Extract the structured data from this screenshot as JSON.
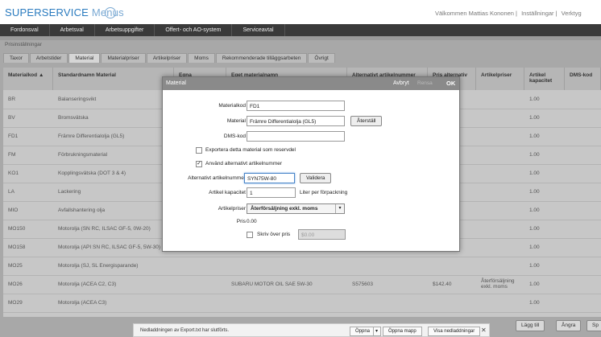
{
  "header": {
    "logo_main": "SUPERSERVICE",
    "logo_sub": "Menus",
    "welcome": "Välkommen Mattias Kononen",
    "links": [
      "Inställningar",
      "Verktyg"
    ]
  },
  "mainnav": [
    "Fordonsval",
    "Arbetsval",
    "Arbetsuppgifter",
    "Offert- och AO-system",
    "Serviceavtal"
  ],
  "panel": {
    "title": "Prisinställningar",
    "tabs": [
      "Taxor",
      "Arbetstider",
      "Material",
      "Materialpriser",
      "Artikelpriser",
      "Moms",
      "Rekommenderade tilläggsarbeten",
      "Övrigt"
    ],
    "active_tab": "Material"
  },
  "table": {
    "headers": [
      "Materialkod",
      "Standardnamn Material",
      "Egna",
      "Eget materialnamn",
      "Alternativt artikelnummer",
      "Pris alternativ",
      "Artikelpriser",
      "Artikel kapacitet",
      "DMS-kod"
    ],
    "rows": [
      {
        "code": "BR",
        "name": "Balanseringsvikt",
        "own": "",
        "altno": "",
        "price": "",
        "artpris": "",
        "cap": "1.00"
      },
      {
        "code": "BV",
        "name": "Bromsvätska",
        "own": "",
        "altno": "",
        "price": "",
        "artpris": "",
        "cap": "1.00"
      },
      {
        "code": "FD1",
        "name": "Främre Differentialolja (GL5)",
        "own": "",
        "altno": "",
        "price": "",
        "artpris": "",
        "cap": "1.00"
      },
      {
        "code": "FM",
        "name": "Förbrukningsmaterial",
        "own": "",
        "altno": "",
        "price": "",
        "artpris": "",
        "cap": "1.00"
      },
      {
        "code": "KO1",
        "name": "Kopplingsvätska (DOT 3 & 4)",
        "own": "",
        "altno": "",
        "price": "",
        "artpris": "",
        "cap": "1.00"
      },
      {
        "code": "LA",
        "name": "Lackering",
        "own": "",
        "altno": "",
        "price": "",
        "artpris": "",
        "cap": "1.00"
      },
      {
        "code": "MIO",
        "name": "Avfallshantering olja",
        "own": "",
        "altno": "",
        "price": "",
        "artpris": "",
        "cap": "1.00"
      },
      {
        "code": "MO150",
        "name": "Motorolja (SN RC, ILSAC GF-5, 0W-20)",
        "own": "",
        "altno": "",
        "price": "",
        "artpris": "",
        "cap": "1.00"
      },
      {
        "code": "MO158",
        "name": "Motorolja (API SN RC, ILSAC GF-5, 5W-30)",
        "own": "",
        "altno": "",
        "price": "",
        "artpris": "",
        "cap": "1.00"
      },
      {
        "code": "MO25",
        "name": "Motorolja (SJ, SL Energisparande)",
        "own": "",
        "altno": "",
        "price": "",
        "artpris": "",
        "cap": "1.00"
      },
      {
        "code": "MO26",
        "name": "Motorolja (ACEA C2, C3)",
        "own": "SUBARU MOTOR OIL SAE 5W-30",
        "altno": "S575603",
        "price": "$142.40",
        "artpris": "Återförsäljning exkl. moms",
        "cap": "1.00"
      },
      {
        "code": "MO29",
        "name": "Motorolja (ACEA C3)",
        "own": "",
        "altno": "",
        "price": "",
        "artpris": "",
        "cap": "1.00"
      },
      {
        "code": "MO30",
        "name": "Motorolja (SL/SM EC, ILSAC)",
        "own": "",
        "altno": "",
        "price": "",
        "artpris": "",
        "cap": "1.00"
      }
    ]
  },
  "bottom_buttons": [
    "Lägg till",
    "Ångra",
    "Sp"
  ],
  "download": {
    "text": "Nedladdningen av Export.txt har slutförts.",
    "open": "Öppna",
    "open_folder": "Öppna mapp",
    "view": "Visa nedladdningar"
  },
  "dialog": {
    "title": "Material",
    "cancel": "Avbryt",
    "clear": "Rensa",
    "ok": "OK",
    "materialkod_label": "Materialkod",
    "materialkod_value": "FD1",
    "material_label": "Material",
    "material_value": "Främre Differentialolja (GL5)",
    "reset_button": "Återställ",
    "dms_label": "DMS-kod",
    "dms_value": "",
    "export_checkbox": "Exportera detta material som reservdel",
    "export_checked": false,
    "alt_checkbox": "Använd alternativt artikelnummer",
    "alt_checked": true,
    "altno_label": "Alternativt artikelnummer",
    "altno_value": "SYN75W-80",
    "validate_button": "Validera",
    "capacity_label": "Artikel kapacitet",
    "capacity_value": "1",
    "capacity_unit": "Liter per förpackning",
    "artpris_label": "Artikelpriser",
    "artpris_value": "Återförsäljning exkl. moms",
    "pris_label": "Pris",
    "pris_value": "0.00",
    "override_checkbox": "Skriv över pris",
    "override_checked": false,
    "override_value": "$0.00"
  }
}
